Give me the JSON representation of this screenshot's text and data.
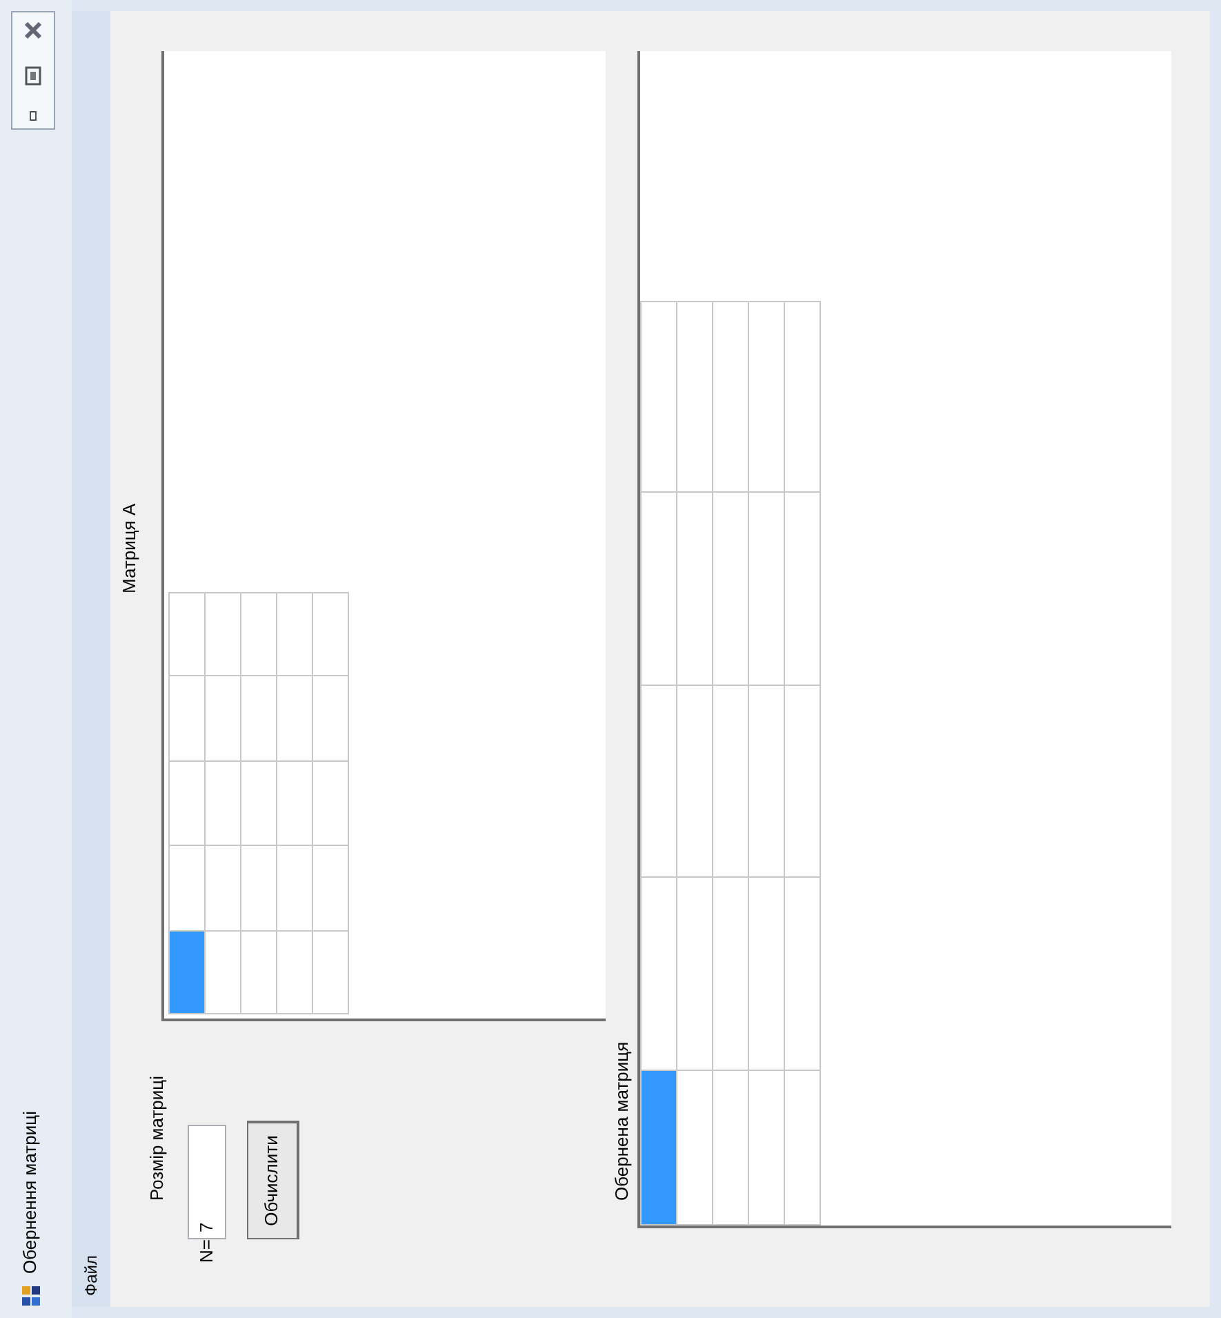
{
  "window": {
    "title": "Обернення матриці"
  },
  "menu": [
    "Файл"
  ],
  "size_panel": {
    "label": "Розмір матриці",
    "n_label": "N=",
    "n_value": "7",
    "button": "Обчислити"
  },
  "matrix_a": {
    "label": "Матриця A",
    "rows": [
      [
        {
          "selected": true
        },
        {
          "selected": false
        },
        {
          "selected": false
        },
        {
          "selected": false
        },
        {
          "selected": false
        }
      ],
      [
        {
          "selected": false
        },
        {
          "selected": false
        },
        {
          "selected": false
        },
        {
          "selected": false
        },
        {
          "selected": false
        }
      ],
      [
        {
          "selected": false
        },
        {
          "selected": false
        },
        {
          "selected": false
        },
        {
          "selected": false
        },
        {
          "selected": false
        }
      ],
      [
        {
          "selected": false
        },
        {
          "selected": false
        },
        {
          "selected": false
        },
        {
          "selected": false
        },
        {
          "selected": false
        }
      ],
      [
        {
          "selected": false
        },
        {
          "selected": false
        },
        {
          "selected": false
        },
        {
          "selected": false
        },
        {
          "selected": false
        }
      ]
    ]
  },
  "inverse": {
    "label": "Обернена матриця",
    "rows": [
      [
        {
          "selected": true
        },
        {
          "selected": false
        },
        {
          "selected": false
        },
        {
          "selected": false
        },
        {
          "selected": false
        }
      ],
      [
        {
          "selected": false
        },
        {
          "selected": false
        },
        {
          "selected": false
        },
        {
          "selected": false
        },
        {
          "selected": false
        }
      ],
      [
        {
          "selected": false
        },
        {
          "selected": false
        },
        {
          "selected": false
        },
        {
          "selected": false
        },
        {
          "selected": false
        }
      ],
      [
        {
          "selected": false
        },
        {
          "selected": false
        },
        {
          "selected": false
        },
        {
          "selected": false
        },
        {
          "selected": false
        }
      ],
      [
        {
          "selected": false
        },
        {
          "selected": false
        },
        {
          "selected": false
        },
        {
          "selected": false
        },
        {
          "selected": false
        }
      ]
    ]
  }
}
